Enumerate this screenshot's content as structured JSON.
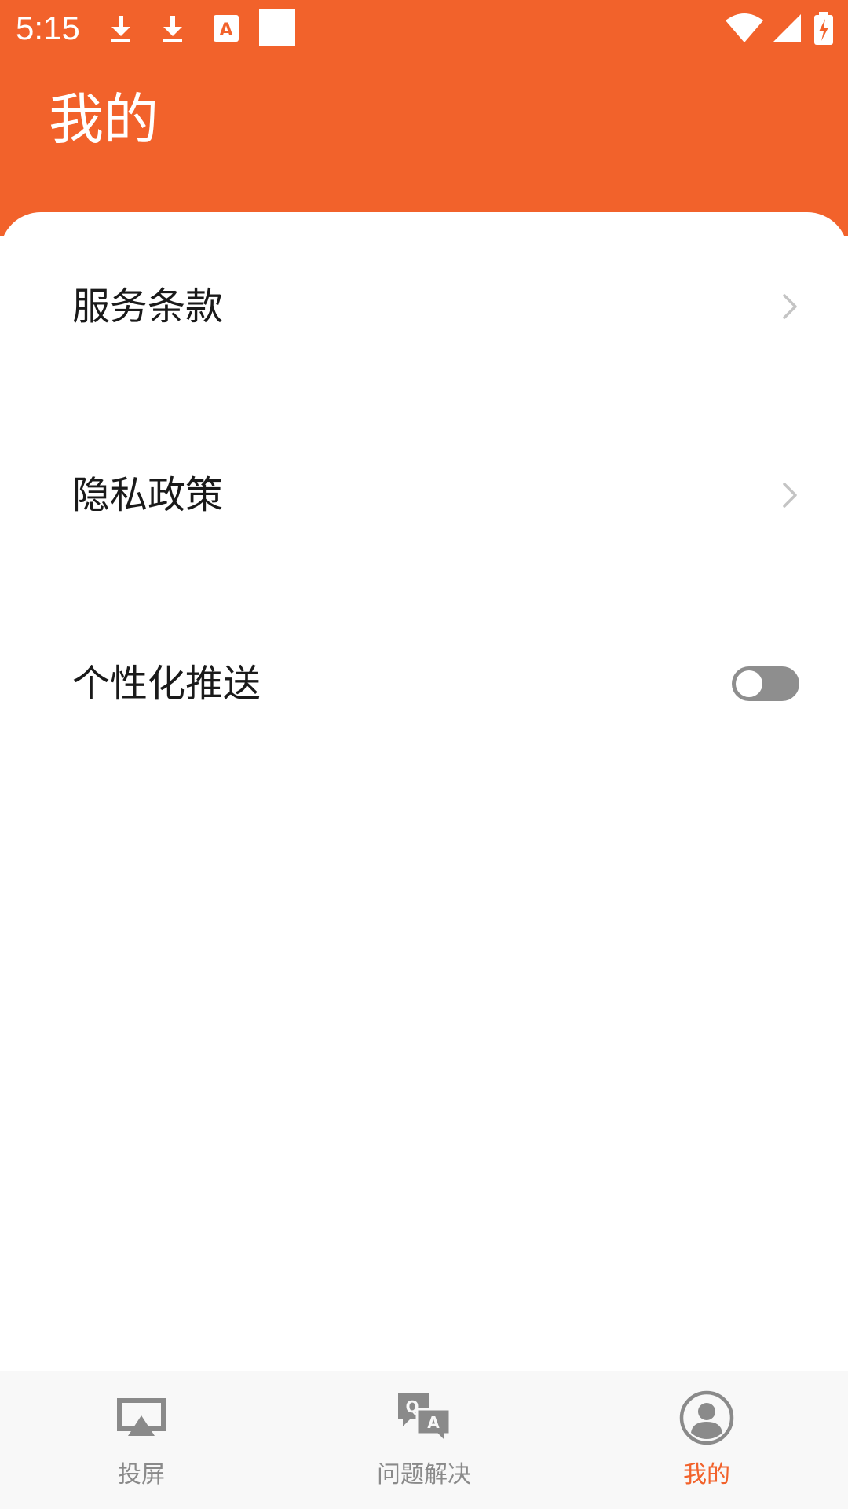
{
  "status_bar": {
    "time": "5:15",
    "icons": [
      "download-icon",
      "download-icon",
      "text-a-icon",
      "square-icon",
      "wifi-icon",
      "cell-signal-icon",
      "battery-charging-icon"
    ]
  },
  "header": {
    "title": "我的"
  },
  "settings": {
    "items": [
      {
        "label": "服务条款",
        "control": "chevron-right-icon"
      },
      {
        "label": "隐私政策",
        "control": "chevron-right-icon"
      },
      {
        "label": "个性化推送",
        "control": "toggle",
        "enabled": false
      }
    ]
  },
  "bottom_nav": {
    "items": [
      {
        "label": "投屏",
        "icon": "cast-screen-icon",
        "active": false
      },
      {
        "label": "问题解决",
        "icon": "qa-chat-icon",
        "active": false
      },
      {
        "label": "我的",
        "icon": "user-profile-icon",
        "active": true
      }
    ]
  },
  "colors": {
    "accent": "#F2622B",
    "nav_inactive": "#8A8A8A",
    "toggle_off": "#8E8E8E"
  }
}
